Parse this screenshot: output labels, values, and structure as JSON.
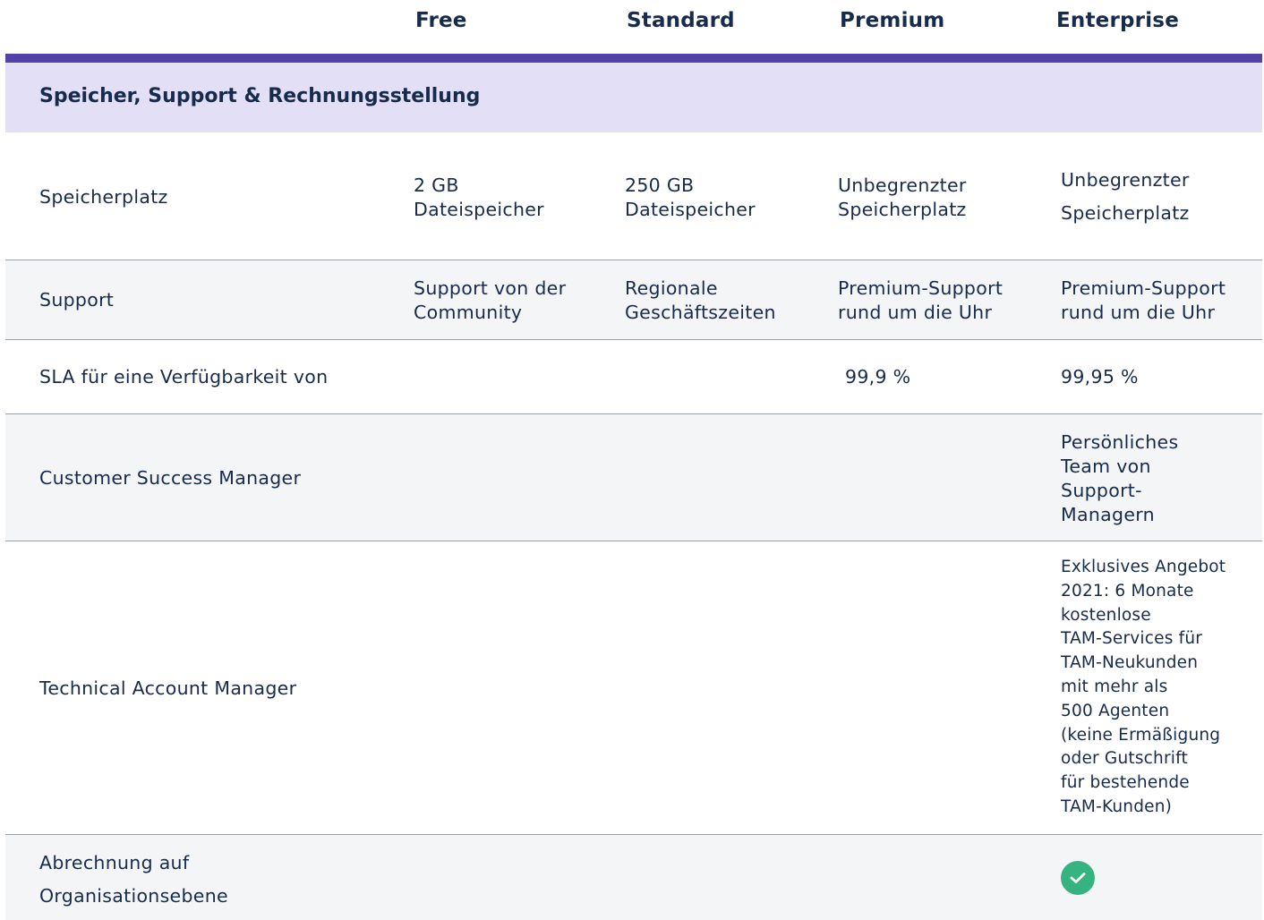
{
  "plans": [
    "Free",
    "Standard",
    "Premium",
    "Enterprise"
  ],
  "section": {
    "title": "Speicher, Support & Rechnungsstellung"
  },
  "rows": [
    {
      "feature": "Speicherplatz",
      "free": "2 GB\nDateispeicher",
      "standard": "250 GB\nDateispeicher",
      "premium": "Unbegrenzter\nSpeicherplatz",
      "enterprise": "Unbegrenzter\nSpeicherplatz"
    },
    {
      "feature": "Support",
      "free": "Support von der\nCommunity",
      "standard": "Regionale\nGeschäftszeiten",
      "premium": "Premium-Support\nrund um die Uhr",
      "enterprise": "Premium-Support\nrund um die Uhr"
    },
    {
      "feature": "SLA für eine Verfügbarkeit von",
      "premium": "99,9 %",
      "enterprise": "99,95 %"
    },
    {
      "feature": "Customer Success Manager",
      "enterprise": "Persönliches\nTeam von\nSupport-\nManagern"
    },
    {
      "feature": "Technical Account Manager",
      "enterprise": "Exklusives Angebot\n2021: 6 Monate\nkostenlose\nTAM-Services für\nTAM-Neukunden\nmit mehr als\n500 Agenten\n(keine Ermäßigung\noder Gutschrift\nfür bestehende\nTAM-Kunden)"
    },
    {
      "feature": "Abrechnung auf\nOrganisationsebene",
      "enterprise_icon": "check-circle-icon"
    }
  ],
  "colors": {
    "accent": "#5243aa",
    "section_band": "#e3dff7",
    "row_alt": "#f4f5f7",
    "check": "#36b37e",
    "text": "#172b4d"
  }
}
